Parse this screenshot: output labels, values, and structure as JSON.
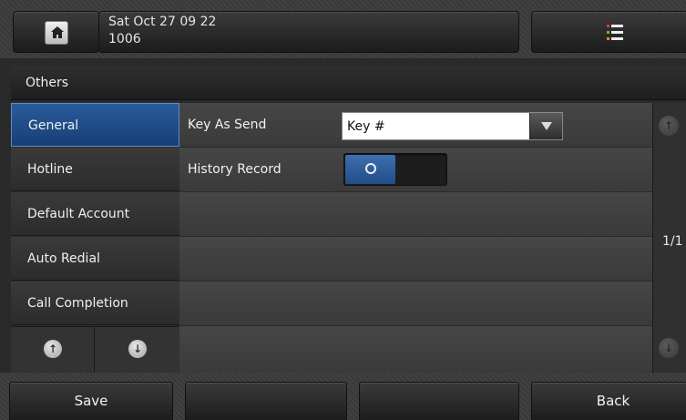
{
  "status_bar": {
    "date_time": "Sat Oct 27 09 22",
    "extension": "1006",
    "home_icon": "home-icon",
    "menu_icon": "menu-list-icon"
  },
  "title": "Others",
  "sidebar": {
    "items": [
      {
        "label": "General",
        "active": true
      },
      {
        "label": "Hotline",
        "active": false
      },
      {
        "label": "Default Account",
        "active": false
      },
      {
        "label": "Auto Redial",
        "active": false
      },
      {
        "label": "Call Completion",
        "active": false
      }
    ]
  },
  "settings": {
    "key_as_send": {
      "label": "Key As Send",
      "value": "Key #"
    },
    "history_record": {
      "label": "History Record",
      "state": "on"
    }
  },
  "pager": {
    "indicator": "1/1"
  },
  "softkeys": {
    "key1": "Save",
    "key2": "",
    "key3": "",
    "key4": "Back"
  },
  "colors": {
    "active_item": "#1f4d8c",
    "menu_icon_accents": [
      "#e53935",
      "#7cb342",
      "#fb8c00"
    ]
  }
}
